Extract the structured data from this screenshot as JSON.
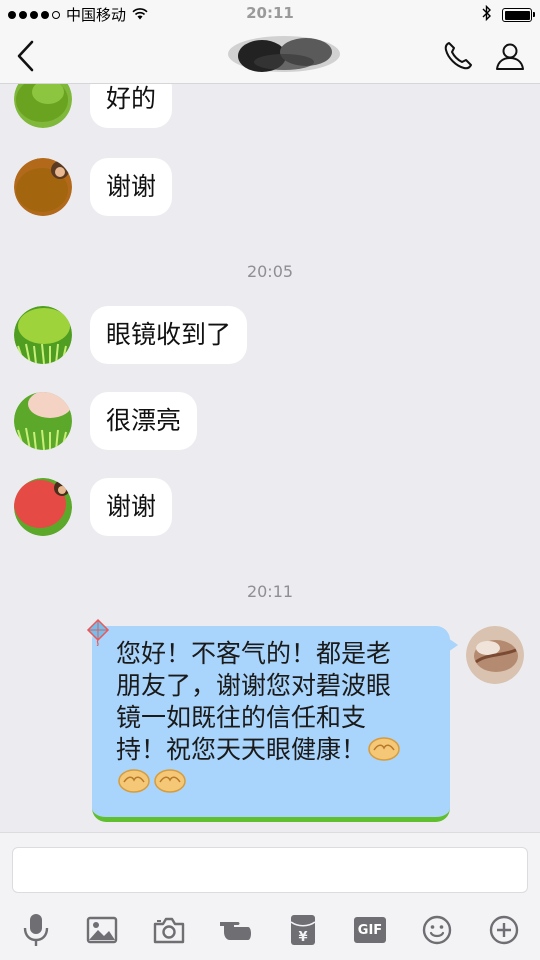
{
  "status_bar": {
    "carrier": "中国移动",
    "time": "20:11",
    "signal_dots": [
      true,
      true,
      true,
      true,
      false
    ]
  },
  "nav": {
    "back_icon": "chevron-left-icon",
    "call_icon": "phone-icon",
    "profile_icon": "person-icon"
  },
  "messages": [
    {
      "side": "left",
      "text": "好的"
    },
    {
      "side": "left",
      "text": "谢谢"
    },
    {
      "type": "timestamp",
      "text": "20:05"
    },
    {
      "side": "left",
      "text": "眼镜收到了"
    },
    {
      "side": "left",
      "text": "很漂亮"
    },
    {
      "side": "left",
      "text": "谢谢"
    },
    {
      "type": "timestamp",
      "text": "20:11"
    },
    {
      "side": "right",
      "lines": [
        "您好！不客气的！都是老",
        "朋友了，谢谢您对碧波眼",
        "镜一如既往的信任和支",
        "持！祝您天天眼健康！"
      ]
    }
  ],
  "input": {
    "placeholder": "",
    "value": ""
  },
  "toolbar": [
    {
      "name": "microphone-icon"
    },
    {
      "name": "image-icon"
    },
    {
      "name": "camera-icon"
    },
    {
      "name": "poke-icon"
    },
    {
      "name": "red-packet-icon"
    },
    {
      "name": "gif-icon",
      "label": "GIF"
    },
    {
      "name": "emoji-icon"
    },
    {
      "name": "plus-icon"
    }
  ],
  "colors": {
    "my_bubble": "#a9d4fb",
    "their_bubble": "#ffffff",
    "background": "#ebebf0",
    "icon": "#6e6e73"
  }
}
